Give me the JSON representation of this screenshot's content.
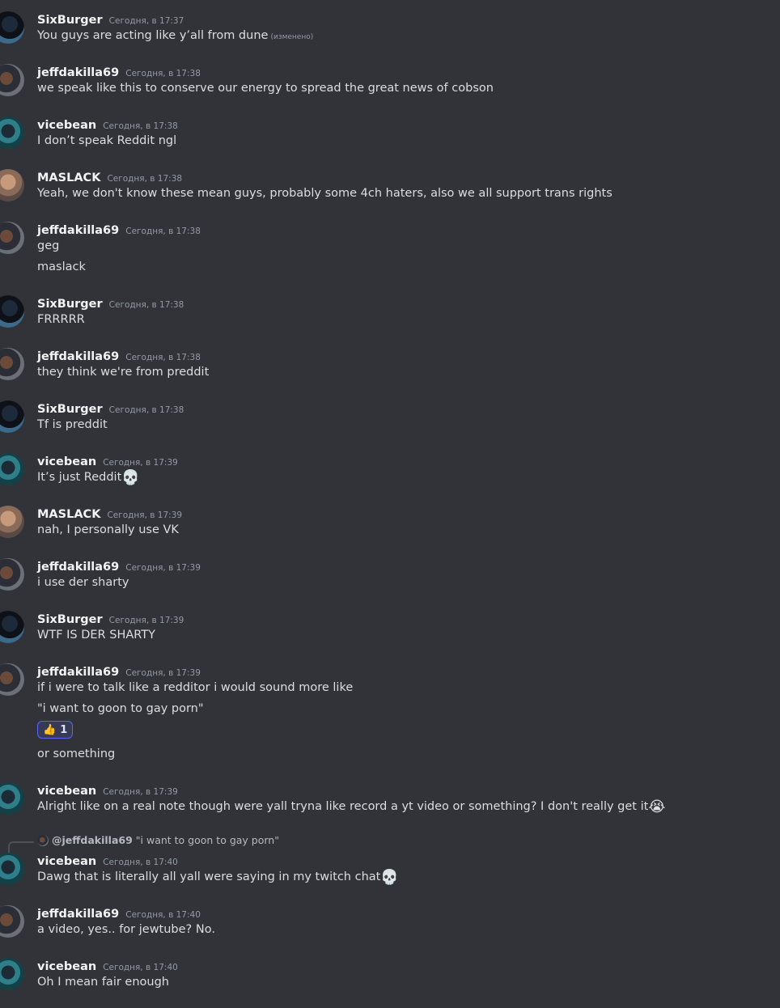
{
  "messages": [
    {
      "author": "SixBurger",
      "avatar": "sixburger",
      "time": "Сегодня, в 17:37",
      "lines": [
        "You guys are acting like y’all from dune"
      ],
      "edited": "(изменено)"
    },
    {
      "author": "jeffdakilla69",
      "avatar": "jeff",
      "time": "Сегодня, в 17:38",
      "lines": [
        "we speak like this to conserve our energy to spread the great news of cobson"
      ]
    },
    {
      "author": "vicebean",
      "avatar": "vice",
      "time": "Сегодня, в 17:38",
      "lines": [
        "I don’t speak Reddit ngl"
      ]
    },
    {
      "author": "MASLACK",
      "avatar": "maslack",
      "time": "Сегодня, в 17:38",
      "lines": [
        "Yeah, we don't know these mean guys, probably some 4ch haters, also we all support trans rights"
      ]
    },
    {
      "author": "jeffdakilla69",
      "avatar": "jeff",
      "time": "Сегодня, в 17:38",
      "lines": [
        "geg",
        "maslack"
      ]
    },
    {
      "author": "SixBurger",
      "avatar": "sixburger",
      "time": "Сегодня, в 17:38",
      "lines": [
        "FRRRRR"
      ]
    },
    {
      "author": "jeffdakilla69",
      "avatar": "jeff",
      "time": "Сегодня, в 17:38",
      "lines": [
        "they think we're from preddit"
      ]
    },
    {
      "author": "SixBurger",
      "avatar": "sixburger",
      "time": "Сегодня, в 17:38",
      "lines": [
        "Tf is preddit"
      ]
    },
    {
      "author": "vicebean",
      "avatar": "vice",
      "time": "Сегодня, в 17:39",
      "lines": [
        "It’s just Reddit"
      ],
      "emoji": "💀"
    },
    {
      "author": "MASLACK",
      "avatar": "maslack",
      "time": "Сегодня, в 17:39",
      "lines": [
        "nah, I personally use VK"
      ]
    },
    {
      "author": "jeffdakilla69",
      "avatar": "jeff",
      "time": "Сегодня, в 17:39",
      "lines": [
        "i use der sharty"
      ]
    },
    {
      "author": "SixBurger",
      "avatar": "sixburger",
      "time": "Сегодня, в 17:39",
      "lines": [
        "WTF IS DER SHARTY"
      ]
    },
    {
      "author": "jeffdakilla69",
      "avatar": "jeff",
      "time": "Сегодня, в 17:39",
      "lines": [
        "if i were to talk like a redditor i would sound more like",
        "\"i want to goon to gay porn\"",
        "or something"
      ],
      "reaction": {
        "emoji": "👍",
        "count": "1"
      }
    },
    {
      "author": "vicebean",
      "avatar": "vice",
      "time": "Сегодня, в 17:39",
      "lines": [
        "Alright like on a real note though were yall tryna like record a yt video or something? I don't really get it"
      ],
      "emoji": "😭"
    },
    {
      "author": "vicebean",
      "avatar": "vice",
      "time": "Сегодня, в 17:40",
      "lines": [
        "Dawg that is literally all yall were saying in my twitch chat"
      ],
      "emoji": "💀",
      "reply": {
        "mention": "@jeffdakilla69",
        "text": "\"i want to goon to gay porn\""
      }
    },
    {
      "author": "jeffdakilla69",
      "avatar": "jeff",
      "time": "Сегодня, в 17:40",
      "lines": [
        "a video, yes.. for jewtube? No."
      ]
    },
    {
      "author": "vicebean",
      "avatar": "vice",
      "time": "Сегодня, в 17:40",
      "lines": [
        "Oh I mean fair enough"
      ]
    }
  ]
}
